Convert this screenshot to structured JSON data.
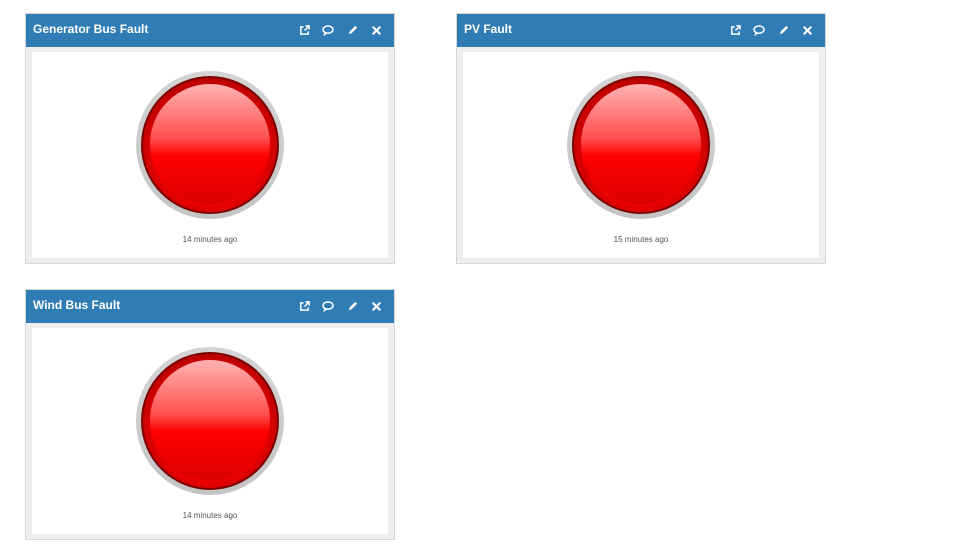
{
  "colors": {
    "header_bg": "#2f7db4",
    "led_red": "#ff0000",
    "led_status": "fault"
  },
  "widgets": [
    {
      "title": "Generator Bus Fault",
      "timestamp": "14 minutes ago",
      "tools": [
        "external-link-icon",
        "comment-icon",
        "edit-pencil-icon",
        "close-icon"
      ]
    },
    {
      "title": "PV Fault",
      "timestamp": "15 minutes ago",
      "tools": [
        "external-link-icon",
        "comment-icon",
        "edit-pencil-icon",
        "close-icon"
      ]
    },
    {
      "title": "Wind Bus Fault",
      "timestamp": "14 minutes ago",
      "tools": [
        "external-link-icon",
        "comment-icon",
        "edit-pencil-icon",
        "close-icon"
      ]
    }
  ]
}
